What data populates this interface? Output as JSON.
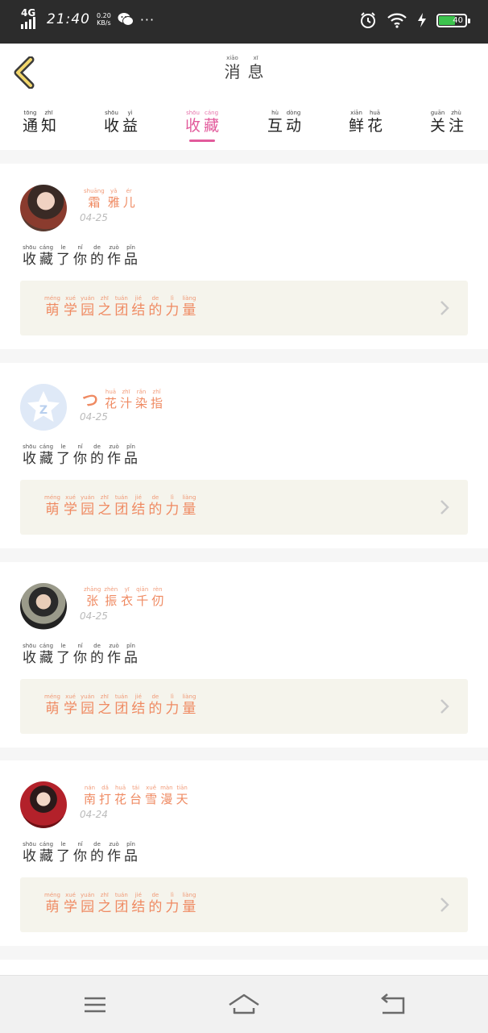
{
  "status_bar": {
    "network": "4G",
    "time": "21:40",
    "speed_value": "0.20",
    "speed_unit": "KB/s",
    "more": "···",
    "battery": "40",
    "icons": [
      "signal-icon",
      "wechat-icon",
      "alarm-icon",
      "wifi-icon",
      "charging-icon",
      "battery-icon"
    ]
  },
  "header": {
    "title": [
      {
        "hz": "消",
        "py": "xiāo"
      },
      {
        "hz": "息",
        "py": "xī"
      }
    ],
    "back_icon": "chevron-left-icon",
    "accent": "#e25a9b"
  },
  "tabs": [
    {
      "chars": [
        {
          "hz": "通",
          "py": "tōng"
        },
        {
          "hz": "知",
          "py": "zhī"
        }
      ],
      "active": false
    },
    {
      "chars": [
        {
          "hz": "收",
          "py": "shōu"
        },
        {
          "hz": "益",
          "py": "yì"
        }
      ],
      "active": false
    },
    {
      "chars": [
        {
          "hz": "收",
          "py": "shōu"
        },
        {
          "hz": "藏",
          "py": "cáng"
        }
      ],
      "active": true
    },
    {
      "chars": [
        {
          "hz": "互",
          "py": "hù"
        },
        {
          "hz": "动",
          "py": "dòng"
        }
      ],
      "active": false
    },
    {
      "chars": [
        {
          "hz": "鲜",
          "py": "xiān"
        },
        {
          "hz": "花",
          "py": "huā"
        }
      ],
      "active": false
    },
    {
      "chars": [
        {
          "hz": "关",
          "py": "guān"
        },
        {
          "hz": "注",
          "py": "zhù"
        }
      ],
      "active": false
    }
  ],
  "messages": [
    {
      "user": {
        "prefix": "",
        "chars": [
          {
            "hz": "霜",
            "py": "shuāng"
          },
          {
            "hz": "雅",
            "py": "yǎ"
          },
          {
            "hz": "儿",
            "py": "ér"
          }
        ]
      },
      "date": "04-25",
      "text": [
        {
          "hz": "收",
          "py": "shōu"
        },
        {
          "hz": "藏",
          "py": "cáng"
        },
        {
          "hz": "了",
          "py": "le"
        },
        {
          "hz": "你",
          "py": "nǐ"
        },
        {
          "hz": "的",
          "py": "de"
        },
        {
          "hz": "作",
          "py": "zuò"
        },
        {
          "hz": "品",
          "py": "pǐn"
        }
      ],
      "work_title": [
        {
          "hz": "萌",
          "py": "méng"
        },
        {
          "hz": "学",
          "py": "xué"
        },
        {
          "hz": "园",
          "py": "yuán"
        },
        {
          "hz": "之",
          "py": "zhī"
        },
        {
          "hz": "团",
          "py": "tuán"
        },
        {
          "hz": "结",
          "py": "jié"
        },
        {
          "hz": "的",
          "py": "de"
        },
        {
          "hz": "力",
          "py": "lì"
        },
        {
          "hz": "量",
          "py": "liàng"
        }
      ]
    },
    {
      "user": {
        "prefix": "つ",
        "chars": [
          {
            "hz": "花",
            "py": "huā"
          },
          {
            "hz": "汁",
            "py": "zhī"
          },
          {
            "hz": "染",
            "py": "rǎn"
          },
          {
            "hz": "指",
            "py": "zhǐ"
          }
        ]
      },
      "date": "04-25",
      "text": [
        {
          "hz": "收",
          "py": "shōu"
        },
        {
          "hz": "藏",
          "py": "cáng"
        },
        {
          "hz": "了",
          "py": "le"
        },
        {
          "hz": "你",
          "py": "nǐ"
        },
        {
          "hz": "的",
          "py": "de"
        },
        {
          "hz": "作",
          "py": "zuò"
        },
        {
          "hz": "品",
          "py": "pǐn"
        }
      ],
      "work_title": [
        {
          "hz": "萌",
          "py": "méng"
        },
        {
          "hz": "学",
          "py": "xué"
        },
        {
          "hz": "园",
          "py": "yuán"
        },
        {
          "hz": "之",
          "py": "zhī"
        },
        {
          "hz": "团",
          "py": "tuán"
        },
        {
          "hz": "结",
          "py": "jié"
        },
        {
          "hz": "的",
          "py": "de"
        },
        {
          "hz": "力",
          "py": "lì"
        },
        {
          "hz": "量",
          "py": "liàng"
        }
      ]
    },
    {
      "user": {
        "prefix": "",
        "chars": [
          {
            "hz": "张",
            "py": "zhāng"
          },
          {
            "hz": "振",
            "py": "zhèn"
          },
          {
            "hz": "衣",
            "py": "yī"
          },
          {
            "hz": "千",
            "py": "qiān"
          },
          {
            "hz": "仞",
            "py": "rèn"
          }
        ]
      },
      "date": "04-25",
      "text": [
        {
          "hz": "收",
          "py": "shōu"
        },
        {
          "hz": "藏",
          "py": "cáng"
        },
        {
          "hz": "了",
          "py": "le"
        },
        {
          "hz": "你",
          "py": "nǐ"
        },
        {
          "hz": "的",
          "py": "de"
        },
        {
          "hz": "作",
          "py": "zuò"
        },
        {
          "hz": "品",
          "py": "pǐn"
        }
      ],
      "work_title": [
        {
          "hz": "萌",
          "py": "méng"
        },
        {
          "hz": "学",
          "py": "xué"
        },
        {
          "hz": "园",
          "py": "yuán"
        },
        {
          "hz": "之",
          "py": "zhī"
        },
        {
          "hz": "团",
          "py": "tuán"
        },
        {
          "hz": "结",
          "py": "jié"
        },
        {
          "hz": "的",
          "py": "de"
        },
        {
          "hz": "力",
          "py": "lì"
        },
        {
          "hz": "量",
          "py": "liàng"
        }
      ]
    },
    {
      "user": {
        "prefix": "",
        "chars": [
          {
            "hz": "南",
            "py": "nán"
          },
          {
            "hz": "打",
            "py": "dǎ"
          },
          {
            "hz": "花",
            "py": "huā"
          },
          {
            "hz": "台",
            "py": "tái"
          },
          {
            "hz": "雪",
            "py": "xuě"
          },
          {
            "hz": "漫",
            "py": "màn"
          },
          {
            "hz": "天",
            "py": "tiān"
          }
        ]
      },
      "date": "04-24",
      "text": [
        {
          "hz": "收",
          "py": "shōu"
        },
        {
          "hz": "藏",
          "py": "cáng"
        },
        {
          "hz": "了",
          "py": "le"
        },
        {
          "hz": "你",
          "py": "nǐ"
        },
        {
          "hz": "的",
          "py": "de"
        },
        {
          "hz": "作",
          "py": "zuò"
        },
        {
          "hz": "品",
          "py": "pǐn"
        }
      ],
      "work_title": [
        {
          "hz": "萌",
          "py": "méng"
        },
        {
          "hz": "学",
          "py": "xué"
        },
        {
          "hz": "园",
          "py": "yuán"
        },
        {
          "hz": "之",
          "py": "zhī"
        },
        {
          "hz": "团",
          "py": "tuán"
        },
        {
          "hz": "结",
          "py": "jié"
        },
        {
          "hz": "的",
          "py": "de"
        },
        {
          "hz": "力",
          "py": "lì"
        },
        {
          "hz": "量",
          "py": "liàng"
        }
      ]
    }
  ],
  "bottom_nav": [
    "menu-icon",
    "home-icon",
    "back-icon"
  ]
}
